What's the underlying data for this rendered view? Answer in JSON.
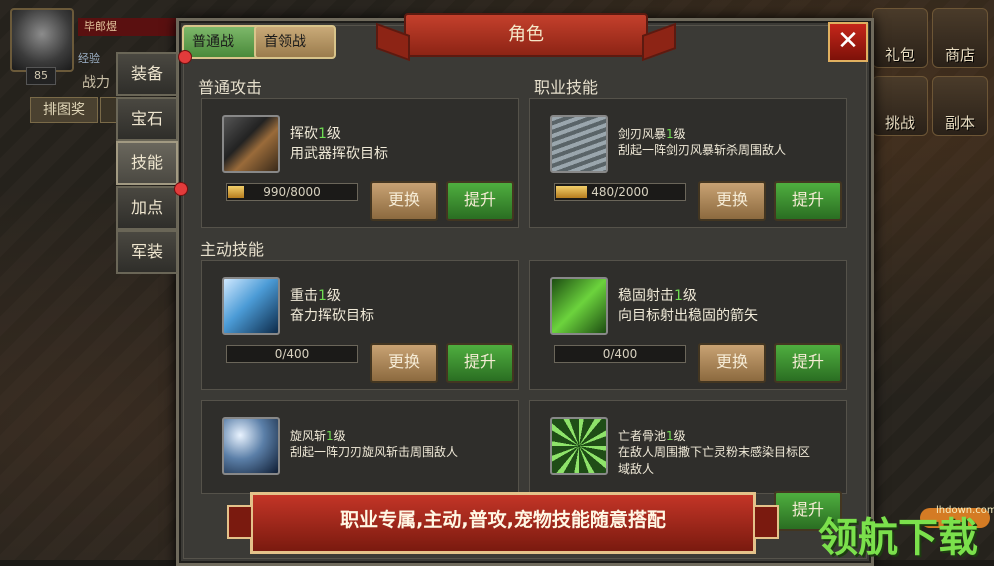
{
  "hud": {
    "name": "毕郎煜",
    "level": "85",
    "exp_label": "经验",
    "power_label": "战力",
    "rank_label": "排图奖"
  },
  "right_icons": [
    "礼包",
    "商店",
    "挑战",
    "副本"
  ],
  "panel": {
    "title": "角色",
    "close_glyph": "✕",
    "top_tabs": [
      "普通战",
      "首领战"
    ],
    "side_tabs": [
      "装备",
      "宝石",
      "技能",
      "加点",
      "军装"
    ],
    "active_side_tab": "技能",
    "sections": {
      "normal_attack": "普通攻击",
      "class_skill": "职业技能",
      "active_skill": "主动技能"
    },
    "skills": [
      {
        "name": "挥砍",
        "level": "1",
        "level_suffix": "级",
        "desc": "用武器挥砍目标",
        "progress_text": "990/8000",
        "progress": 0.12,
        "swap": "更换",
        "upgrade": "提升"
      },
      {
        "name": "剑刃风暴",
        "level": "1",
        "level_suffix": "级",
        "desc": "刮起一阵剑刃风暴斩杀周围敌人",
        "progress_text": "480/2000",
        "progress": 0.24,
        "swap": "更换",
        "upgrade": "提升"
      },
      {
        "name": "重击",
        "level": "1",
        "level_suffix": "级",
        "desc": "奋力挥砍目标",
        "progress_text": "0/400",
        "progress": 0,
        "swap": "更换",
        "upgrade": "提升"
      },
      {
        "name": "稳固射击",
        "level": "1",
        "level_suffix": "级",
        "desc": "向目标射出稳固的箭矢",
        "progress_text": "0/400",
        "progress": 0,
        "swap": "更换",
        "upgrade": "提升"
      },
      {
        "name": "旋风斩",
        "level": "1",
        "level_suffix": "级",
        "desc": "刮起一阵刀刃旋风斩击周围敌人",
        "progress_text": "",
        "progress": 0,
        "swap": "",
        "upgrade": ""
      },
      {
        "name": "亡者骨池",
        "level": "1",
        "level_suffix": "级",
        "desc": "在敌人周围撒下亡灵粉末感染目标区域敌人",
        "progress_text": "",
        "progress": 0,
        "swap": "",
        "upgrade": "提升"
      }
    ]
  },
  "promo_text": "职业专属,主动,普攻,宠物技能随意搭配",
  "watermark": {
    "text": "领航下载",
    "url": "lhdown.com"
  }
}
